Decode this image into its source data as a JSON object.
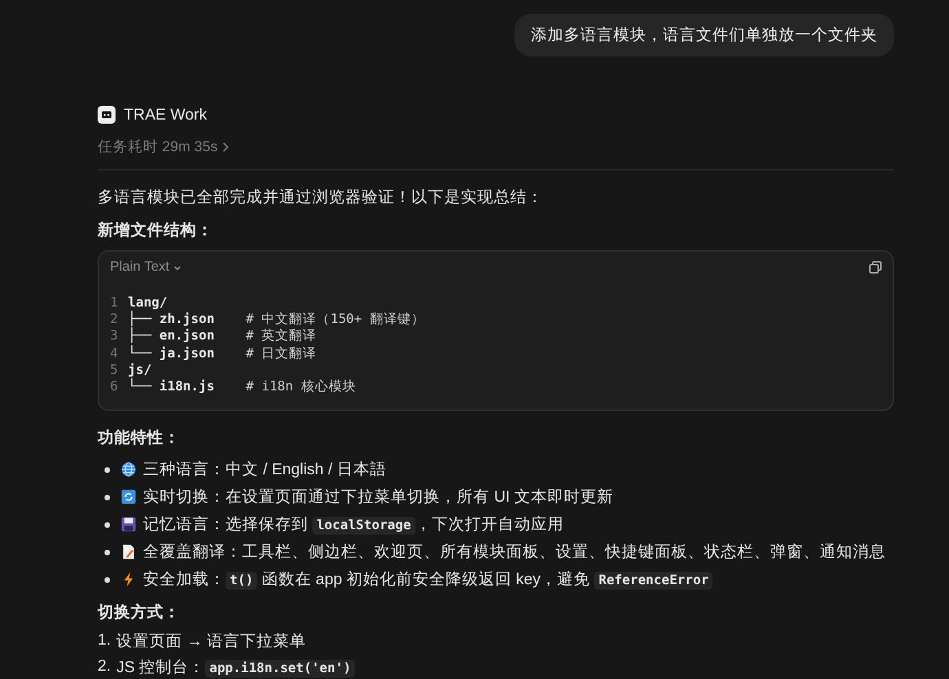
{
  "user_message": "添加多语言模块，语言文件们单独放一个文件夹",
  "agent": {
    "name": "TRAE Work",
    "duration": "任务耗时 29m 35s"
  },
  "summary": "多语言模块已全部完成并通过浏览器验证！以下是实现总结：",
  "file_heading": "新增文件结构：",
  "code_block": {
    "language": "Plain Text",
    "lines": [
      {
        "number": "1",
        "text": "lang/"
      },
      {
        "number": "2",
        "text": "├── zh.json    ",
        "comment": "# 中文翻译（150+ 翻译键）"
      },
      {
        "number": "3",
        "text": "├── en.json    ",
        "comment": "# 英文翻译"
      },
      {
        "number": "4",
        "text": "└── ja.json    ",
        "comment": "# 日文翻译"
      },
      {
        "number": "5",
        "text": "js/"
      },
      {
        "number": "6",
        "text": "└── i18n.js    ",
        "comment": "# i18n 核心模块"
      }
    ]
  },
  "features_heading": "功能特性：",
  "features": [
    {
      "kind": "globe",
      "parts": [
        {
          "kind": "text",
          "text": "三种语言：中文 / English / 日本語"
        }
      ]
    },
    {
      "kind": "refresh",
      "parts": [
        {
          "kind": "text",
          "text": "实时切换：在设置页面通过下拉菜单切换，所有 UI 文本即时更新"
        }
      ]
    },
    {
      "kind": "floppy",
      "parts": [
        {
          "kind": "text",
          "text": "记忆语言：选择保存到 "
        },
        {
          "kind": "code",
          "text": "localStorage"
        },
        {
          "kind": "text",
          "text": "，下次打开自动应用"
        }
      ]
    },
    {
      "kind": "document",
      "parts": [
        {
          "kind": "text",
          "text": "全覆盖翻译：工具栏、侧边栏、欢迎页、所有模块面板、设置、快捷键面板、状态栏、弹窗、通知消息"
        }
      ]
    },
    {
      "kind": "bolt",
      "parts": [
        {
          "kind": "text",
          "text": "安全加载："
        },
        {
          "kind": "code",
          "text": "t()"
        },
        {
          "kind": "text",
          "text": " 函数在 app 初始化前安全降级返回 key，避免 "
        },
        {
          "kind": "code",
          "text": "ReferenceError"
        }
      ]
    }
  ],
  "switch_heading": "切换方式：",
  "switch_steps": [
    {
      "number": "1.",
      "parts": [
        {
          "kind": "text",
          "text": "设置页面 → 语言下拉菜单"
        }
      ]
    },
    {
      "number": "2.",
      "parts": [
        {
          "kind": "text",
          "text": "JS 控制台："
        },
        {
          "kind": "code",
          "text": "app.i18n.set('en')"
        }
      ]
    }
  ]
}
